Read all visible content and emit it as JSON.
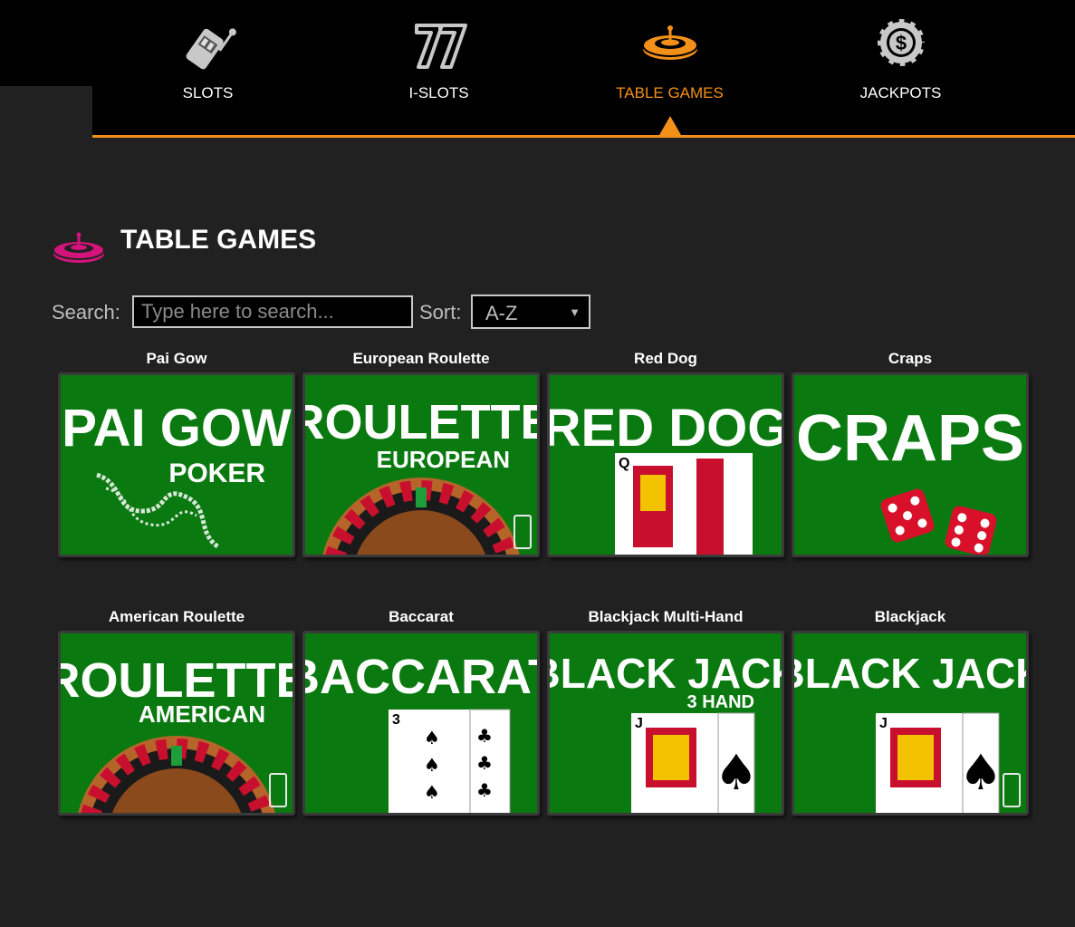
{
  "nav": {
    "items": [
      {
        "label": "SLOTS",
        "icon": "slot-machine-icon",
        "active": false
      },
      {
        "label": "I-SLOTS",
        "icon": "lucky-seven-icon",
        "active": false
      },
      {
        "label": "TABLE GAMES",
        "icon": "roulette-wheel-icon",
        "active": true
      },
      {
        "label": "JACKPOTS",
        "icon": "dollar-chip-icon",
        "active": false
      }
    ]
  },
  "section": {
    "title": "TABLE GAMES",
    "icon": "roulette-wheel-icon"
  },
  "filters": {
    "search_label": "Search:",
    "search_placeholder": "Type here to search...",
    "search_value": "",
    "sort_label": "Sort:",
    "sort_value": "A-Z"
  },
  "games": [
    {
      "name": "Pai Gow",
      "art_title": "PAI GOW",
      "art_subtitle": "POKER"
    },
    {
      "name": "European Roulette",
      "art_title": "ROULETTE",
      "art_subtitle": "EUROPEAN"
    },
    {
      "name": "Red Dog",
      "art_title": "RED DOG",
      "art_subtitle": ""
    },
    {
      "name": "Craps",
      "art_title": "CRAPS",
      "art_subtitle": ""
    },
    {
      "name": "American Roulette",
      "art_title": "ROULETTE",
      "art_subtitle": "AMERICAN"
    },
    {
      "name": "Baccarat",
      "art_title": "BACCARAT",
      "art_subtitle": ""
    },
    {
      "name": "Blackjack Multi-Hand",
      "art_title": "BLACK JACK",
      "art_subtitle": "3 HAND"
    },
    {
      "name": "Blackjack",
      "art_title": "BLACK JACK",
      "art_subtitle": ""
    }
  ],
  "colors": {
    "accent": "#f39019",
    "section_icon": "#d4147a",
    "card_green": "#0a7a10",
    "background": "#212121"
  }
}
